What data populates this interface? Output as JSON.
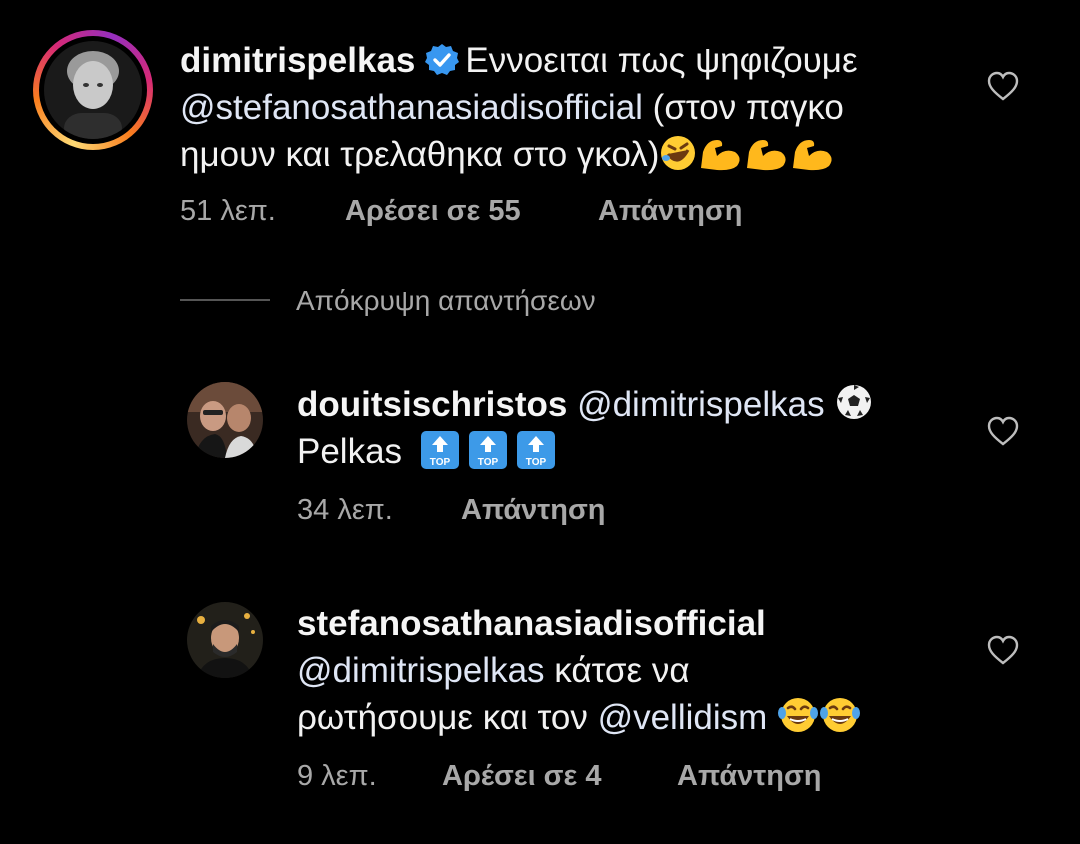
{
  "comment_main": {
    "username": "dimitrispelkas",
    "text_part1": "Εννοειται πως ψηφιζουμε",
    "mention": "@stefanosathanasiadisofficial",
    "text_part2": " (στον παγκο",
    "text_part3": "ημουν και τρελαθηκα στο γκολ)",
    "time": "51 λεπ.",
    "likes": "Αρέσει σε 55",
    "reply": "Απάντηση",
    "verified": true
  },
  "hide_replies": "Απόκρυψη απαντήσεων",
  "reply_1": {
    "username": "douitsischristos",
    "mention": "@dimitrispelkas",
    "text": "Pelkas",
    "time": "34 λεπ.",
    "reply": "Απάντηση"
  },
  "reply_2": {
    "username": "stefanosathanasiadisofficial",
    "mention": "@dimitrispelkas",
    "text_part1": " κάτσε να",
    "text_part2": "ρωτήσουμε και τον ",
    "mention2": "@vellidism",
    "time": "9 λεπ.",
    "likes": "Αρέσει σε 4",
    "reply": "Απάντηση"
  },
  "icons": {
    "heart": "heart-outline-icon",
    "verified": "verified-badge-icon",
    "top": "top-arrow-emoji-icon",
    "soccer": "soccer-ball-emoji-icon",
    "laugh": "laughing-emoji-icon",
    "muscle": "flexed-biceps-emoji-icon",
    "rofl": "rolling-laughing-emoji-icon"
  },
  "colors": {
    "background": "#000000",
    "text": "#f5f5f5",
    "meta": "#a8a8a8",
    "verified": "#3897f0"
  }
}
